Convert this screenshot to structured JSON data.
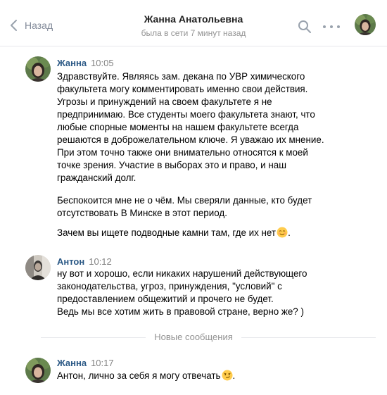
{
  "header": {
    "back_label": "Назад",
    "title": "Жанна Анатольевна",
    "subtitle": "была в сети 7 минут назад"
  },
  "messages": [
    {
      "author": "Жанна",
      "time": "10:05",
      "paragraphs": [
        "Здравствуйте. Являясь зам. декана по УВР химического\nфакультета могу комментировать именно свои действия.\nУгрозы и принуждений на своем факультете я не\nпредпринимаю. Все студенты моего факультета знают, что\nлюбые спорные моменты на нашем факультете всегда\nрешаются в доброжелательном ключе. Я уважаю их мнение.\nПри этом точно также они внимательно относятся к моей\nточке зрения. Участие в выборах это и право, и наш\nгражданский долг.",
        "Беспокоится мне не о чём. Мы сверяли данные, кто будет\nотсутствовать В Минске в этот период.",
        "Зачем вы ищете подводные камни там, где их нет",
        "."
      ]
    },
    {
      "author": "Антон",
      "time": "10:12",
      "text": "ну вот и хорошо, если никаких нарушений действующего\nзаконодательства, угроз, принуждения, \"условий\" с\nпредоставлением общежитий и прочего не будет.\nВедь мы все хотим жить в правовой стране, верно же? )"
    },
    {
      "author": "Жанна",
      "time": "10:17",
      "text": "Антон, лично за себя я могу отвечать",
      "text_end": "."
    }
  ],
  "divider_label": "Новые сообщения",
  "icons": {
    "back": "chevron-left-icon",
    "search": "search-icon",
    "more": "more-dots-icon",
    "emoji_1": "smiling-face-emoji",
    "emoji_2": "smirking-face-emoji"
  },
  "colors": {
    "author_link": "#2a5885",
    "muted": "#828a99",
    "divider": "#e7e8ec"
  }
}
